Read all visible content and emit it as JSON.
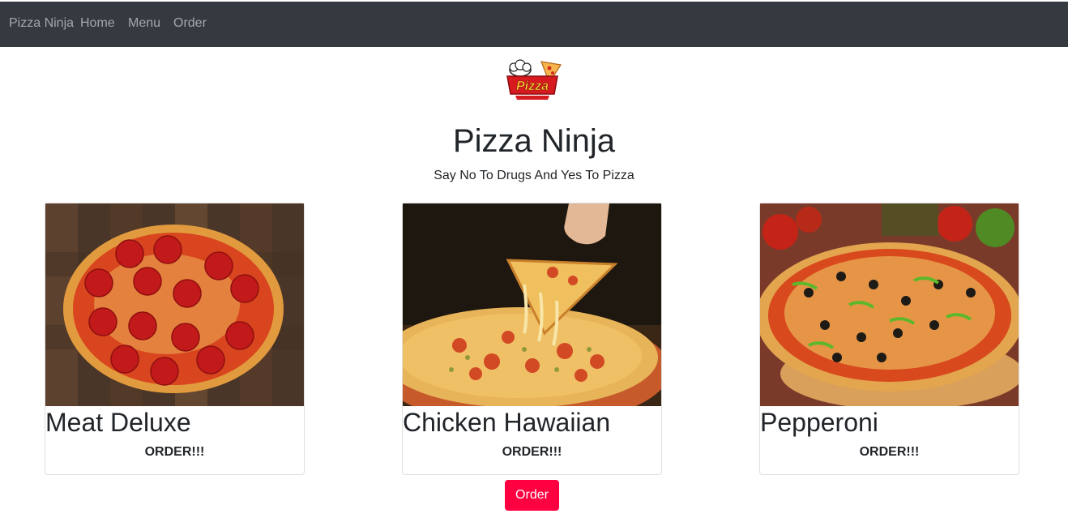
{
  "navbar": {
    "brand": "Pizza Ninja",
    "links": [
      {
        "label": "Home"
      },
      {
        "label": "Menu"
      },
      {
        "label": "Order"
      }
    ]
  },
  "hero": {
    "logo_text": "Pizza",
    "title": "Pizza Ninja",
    "tagline": "Say No To Drugs And Yes To Pizza"
  },
  "cards": [
    {
      "title": "Meat Deluxe",
      "order_label": "ORDER!!!",
      "image": "pepperoni-pizza-on-cutting-board"
    },
    {
      "title": "Chicken Hawaiian",
      "order_label": "ORDER!!!",
      "image": "cheese-pizza-slice-lifted"
    },
    {
      "title": "Pepperoni",
      "order_label": "ORDER!!!",
      "image": "supreme-pizza-with-vegetables"
    }
  ],
  "order_button": {
    "label": "Order"
  },
  "colors": {
    "navbar_bg": "#343a40",
    "order_button_bg": "#ff0040"
  }
}
